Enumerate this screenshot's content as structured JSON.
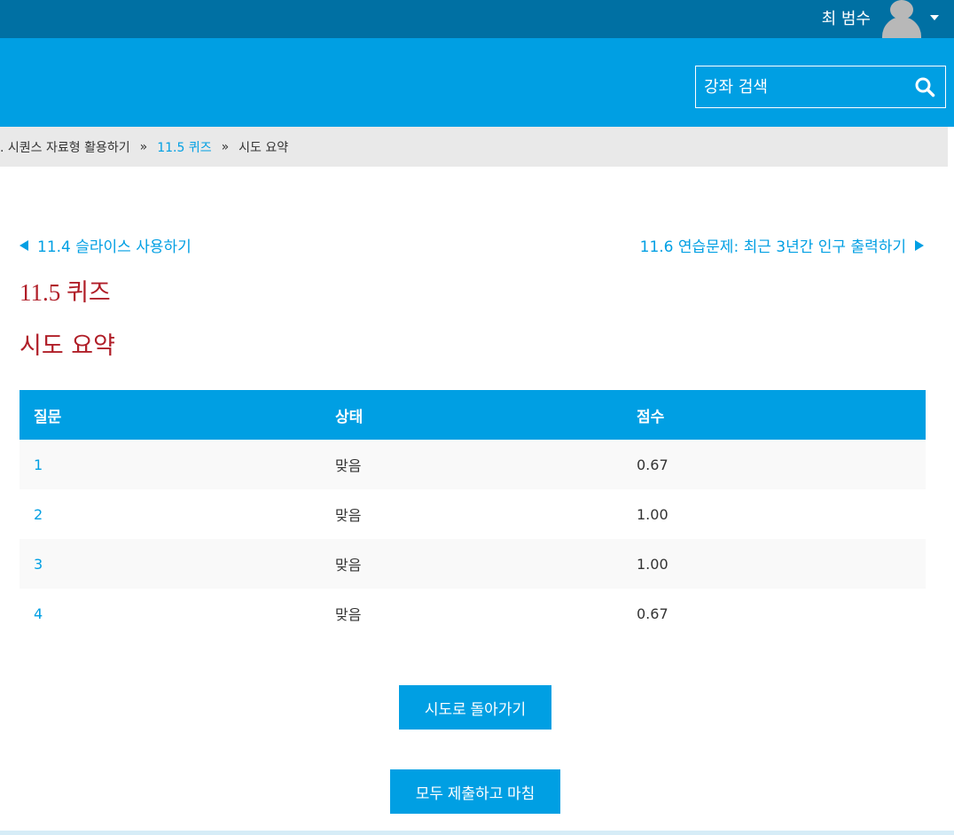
{
  "user": {
    "name": "최 범수"
  },
  "search": {
    "placeholder": "강좌 검색"
  },
  "breadcrumb": {
    "items": [
      ". 시퀀스 자료형 활용하기",
      "11.5 퀴즈",
      "시도 요약"
    ],
    "separator": "»"
  },
  "nav": {
    "prev_label": "11.4 슬라이스 사용하기",
    "next_label": "11.6 연습문제: 최근 3년간 인구 출력하기"
  },
  "quiz_title": "11.5 퀴즈",
  "page_title": "시도 요약",
  "table": {
    "headers": [
      "질문",
      "상태",
      "점수"
    ],
    "rows": [
      {
        "question": "1",
        "status": "맞음",
        "score": "0.67"
      },
      {
        "question": "2",
        "status": "맞음",
        "score": "1.00"
      },
      {
        "question": "3",
        "status": "맞음",
        "score": "1.00"
      },
      {
        "question": "4",
        "status": "맞음",
        "score": "0.67"
      }
    ]
  },
  "buttons": {
    "back": "시도로 돌아가기",
    "submit": "모두 제출하고 마침"
  },
  "colors": {
    "topbar": "#0070a3",
    "header": "#009fe3",
    "link": "#009fe3",
    "title": "#b01e28"
  },
  "icons": {
    "search": "search-icon",
    "avatar": "user-avatar-icon",
    "menu_caret": "caret-down-icon",
    "prev": "triangle-left-icon",
    "next": "triangle-right-icon"
  }
}
